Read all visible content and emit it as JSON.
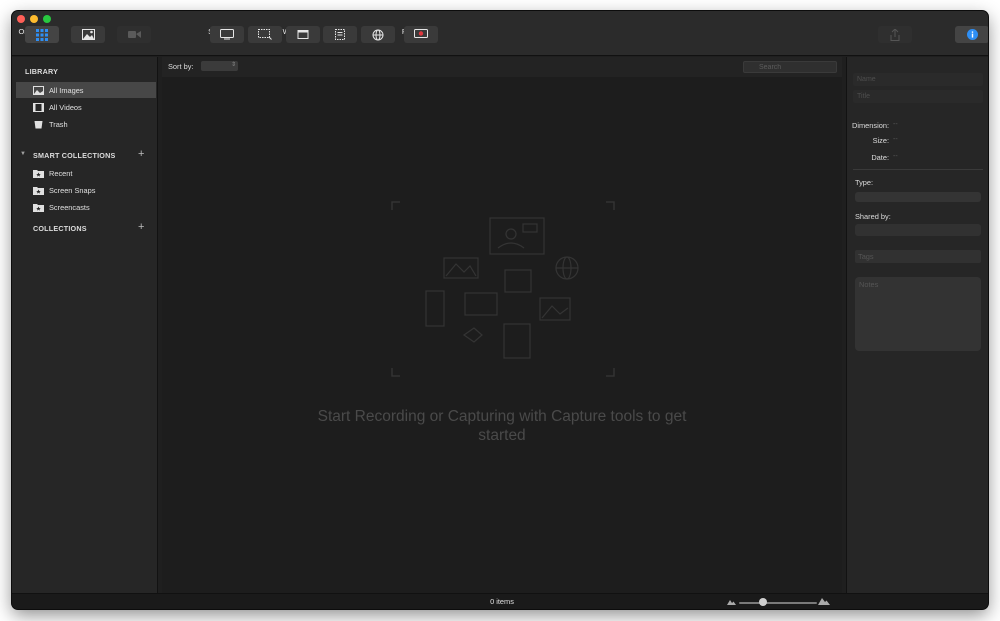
{
  "toolbar": {
    "organizer": "Organizer",
    "image": "Image",
    "video": "Video",
    "screen": "Screen",
    "area": "Area",
    "window": "Window",
    "menu": "Menu",
    "web": "Web",
    "record": "Record",
    "share": "Share",
    "info": "Info"
  },
  "sidebar": {
    "library_header": "LIBRARY",
    "library_items": [
      {
        "label": "All Images",
        "icon": "image-icon",
        "selected": true
      },
      {
        "label": "All Videos",
        "icon": "film-icon",
        "selected": false
      },
      {
        "label": "Trash",
        "icon": "trash-icon",
        "selected": false
      }
    ],
    "smart_header": "SMART COLLECTIONS",
    "smart_items": [
      {
        "label": "Recent",
        "icon": "smart-folder-icon"
      },
      {
        "label": "Screen Snaps",
        "icon": "smart-folder-icon"
      },
      {
        "label": "Screencasts",
        "icon": "smart-folder-icon"
      }
    ],
    "collections_header": "COLLECTIONS"
  },
  "main": {
    "sort_label": "Sort by:",
    "search_placeholder": "Search",
    "empty_text": "Start Recording or Capturing with Capture tools to get started"
  },
  "info_panel": {
    "name_placeholder": "Name",
    "title_placeholder": "Title",
    "dimension_label": "Dimension:",
    "dimension_value": "--",
    "size_label": "Size:",
    "size_value": "--",
    "date_label": "Date:",
    "date_value": "--",
    "type_label": "Type:",
    "shared_by_label": "Shared by:",
    "tags_placeholder": "Tags",
    "notes_placeholder": "Notes"
  },
  "status": {
    "items_count": "0 items"
  },
  "colors": {
    "accent_blue": "#2e8ff5",
    "record_red": "#e0383e"
  }
}
